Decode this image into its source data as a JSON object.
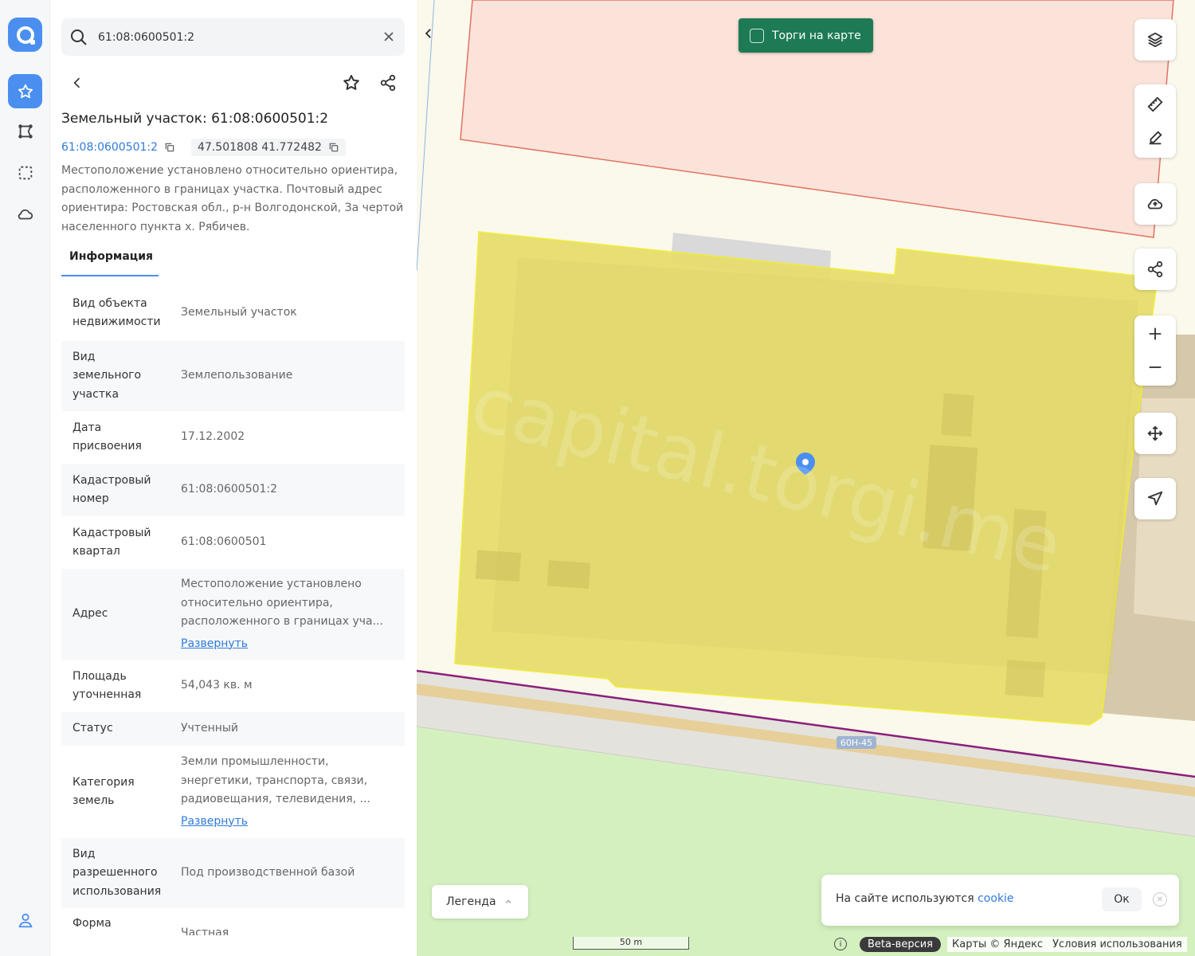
{
  "search": {
    "value": "61:08:0600501:2"
  },
  "parcel": {
    "title": "Земельный участок: 61:08:0600501:2",
    "cad_link": "61:08:0600501:2",
    "coords": "47.501808 41.772482",
    "description": "Местоположение установлено относительно ориентира, расположенного в границах участка. Почтовый адрес ориентира: Ростовская обл., р-н Волгодонской, За чертой населенного пункта х. Рябичев."
  },
  "tabs": {
    "info": "Информация"
  },
  "rows": [
    {
      "k": "Вид объекта недвижимости",
      "v": "Земельный участок"
    },
    {
      "k": "Вид земельного участка",
      "v": "Землепользование"
    },
    {
      "k": "Дата присвоения",
      "v": "17.12.2002"
    },
    {
      "k": "Кадастровый номер",
      "v": "61:08:0600501:2"
    },
    {
      "k": "Кадастровый квартал",
      "v": "61:08:0600501"
    },
    {
      "k": "Адрес",
      "v": "Местоположение установлено относительно ориентира, расположенного в границах уча...",
      "link": "Развернуть"
    },
    {
      "k": "Площадь уточненная",
      "v": "54,043 кв. м"
    },
    {
      "k": "Статус",
      "v": "Учтенный"
    },
    {
      "k": "Категория земель",
      "v": "Земли промышленности, энергетики, транспорта, связи, радиовещания, телевидения, ...",
      "link": "Развернуть"
    },
    {
      "k": "Вид разрешенного использования",
      "v": "Под производственной базой"
    },
    {
      "k": "Форма",
      "v": "Частная"
    }
  ],
  "map": {
    "torgi_label": "Торги на карте",
    "road_label": "60Н-45",
    "watermark": "capital.torgi.me",
    "legend_label": "Легенда",
    "cookie_text": "На сайте используются",
    "cookie_link": "cookie",
    "cookie_ok": "Ок",
    "scale_label": "50 m",
    "beta": "Beta-версия",
    "maps_credit": "Карты © Яндекс",
    "terms": "Условия использования",
    "colors": {
      "parcel_fill": "#e6de6e",
      "accent": "#4a8ff0",
      "torgi_bg": "#1d7a55"
    }
  }
}
